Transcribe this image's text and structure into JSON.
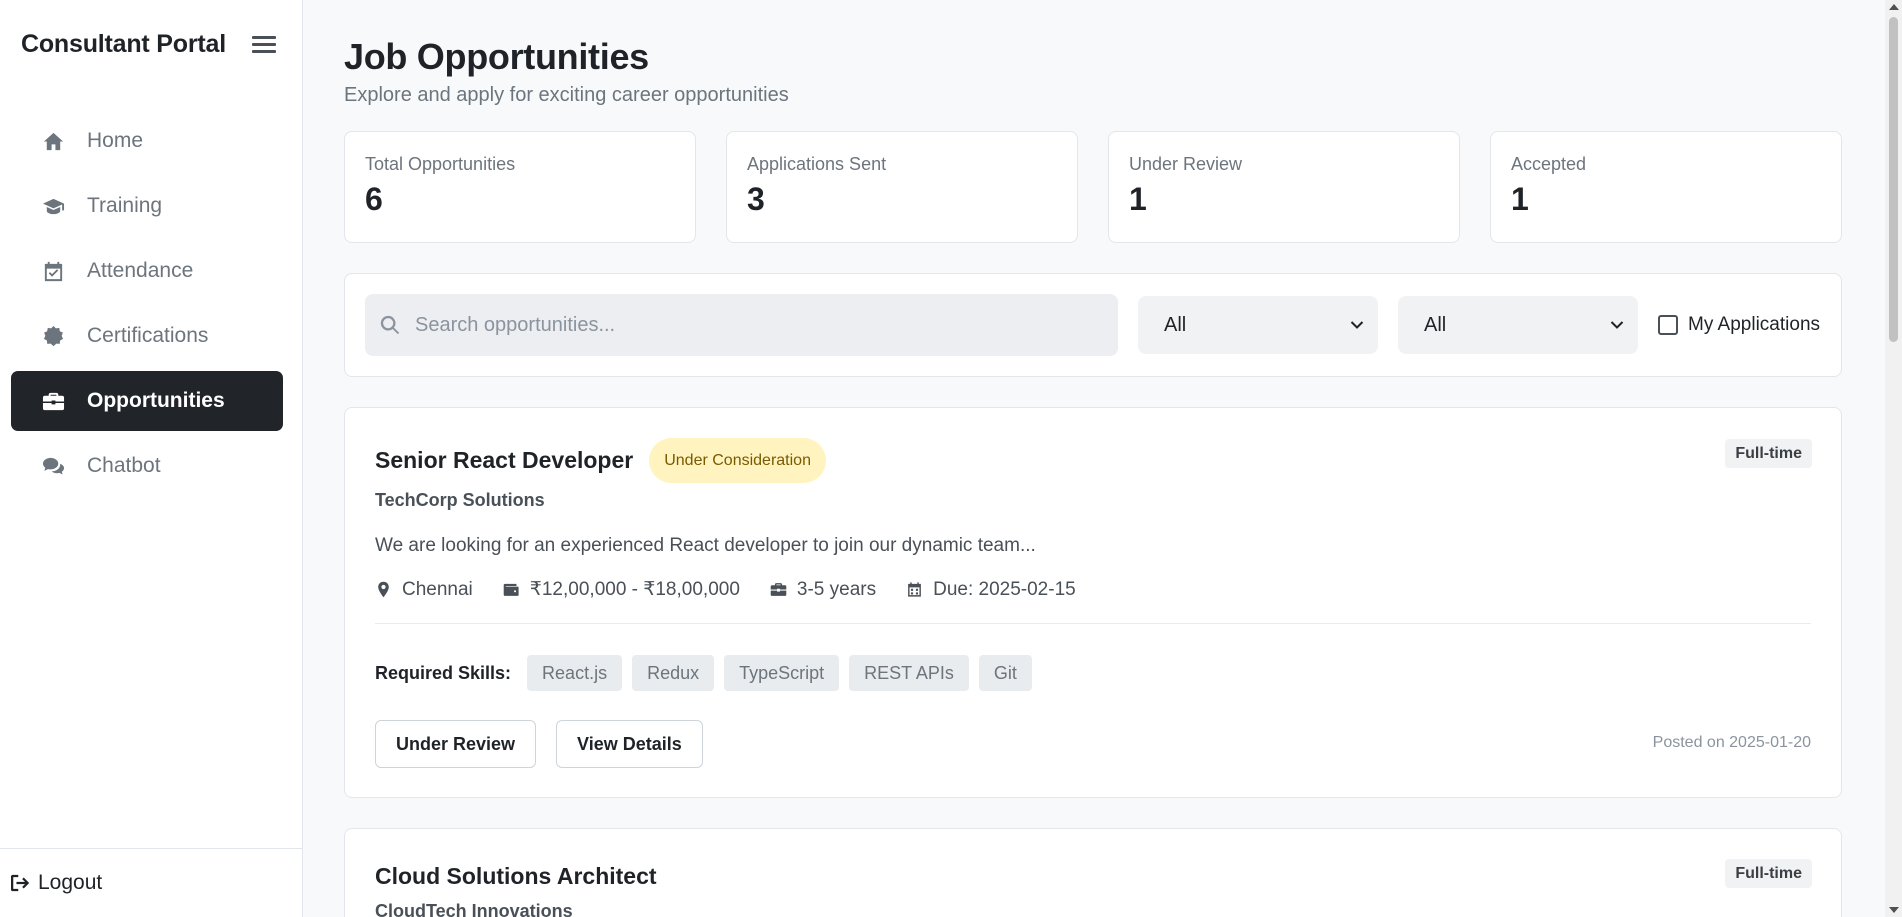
{
  "sidebar": {
    "brand": "Consultant Portal",
    "items": [
      {
        "label": "Home",
        "icon": "home-icon"
      },
      {
        "label": "Training",
        "icon": "graduation-cap-icon"
      },
      {
        "label": "Attendance",
        "icon": "calendar-check-icon"
      },
      {
        "label": "Certifications",
        "icon": "certificate-icon"
      },
      {
        "label": "Opportunities",
        "icon": "briefcase-icon",
        "active": true
      },
      {
        "label": "Chatbot",
        "icon": "comments-icon"
      }
    ],
    "logout_label": "Logout"
  },
  "header": {
    "title": "Job Opportunities",
    "subtitle": "Explore and apply for exciting career opportunities"
  },
  "stats": [
    {
      "label": "Total Opportunities",
      "value": "6"
    },
    {
      "label": "Applications Sent",
      "value": "3"
    },
    {
      "label": "Under Review",
      "value": "1"
    },
    {
      "label": "Accepted",
      "value": "1"
    }
  ],
  "filters": {
    "search_placeholder": "Search opportunities...",
    "search_value": "",
    "select1_value": "All",
    "select2_value": "All",
    "my_applications_label": "My Applications",
    "my_applications_checked": false
  },
  "jobs": [
    {
      "title": "Senior React Developer",
      "status": "Under Consideration",
      "type": "Full-time",
      "company": "TechCorp Solutions",
      "description": "We are looking for an experienced React developer to join our dynamic team...",
      "location": "Chennai",
      "salary": "₹12,00,000 - ₹18,00,000",
      "experience": "3-5 years",
      "due": "Due: 2025-02-15",
      "skills_label": "Required Skills:",
      "skills": [
        "React.js",
        "Redux",
        "TypeScript",
        "REST APIs",
        "Git"
      ],
      "primary_action": "Under Review",
      "secondary_action": "View Details",
      "posted": "Posted on 2025-01-20"
    },
    {
      "title": "Cloud Solutions Architect",
      "type": "Full-time",
      "company": "CloudTech Innovations"
    }
  ],
  "colors": {
    "active_nav_bg": "#212529",
    "status_badge_bg": "#fff3bf",
    "status_badge_text": "#7a5a00",
    "page_bg": "#f8f9fa"
  }
}
